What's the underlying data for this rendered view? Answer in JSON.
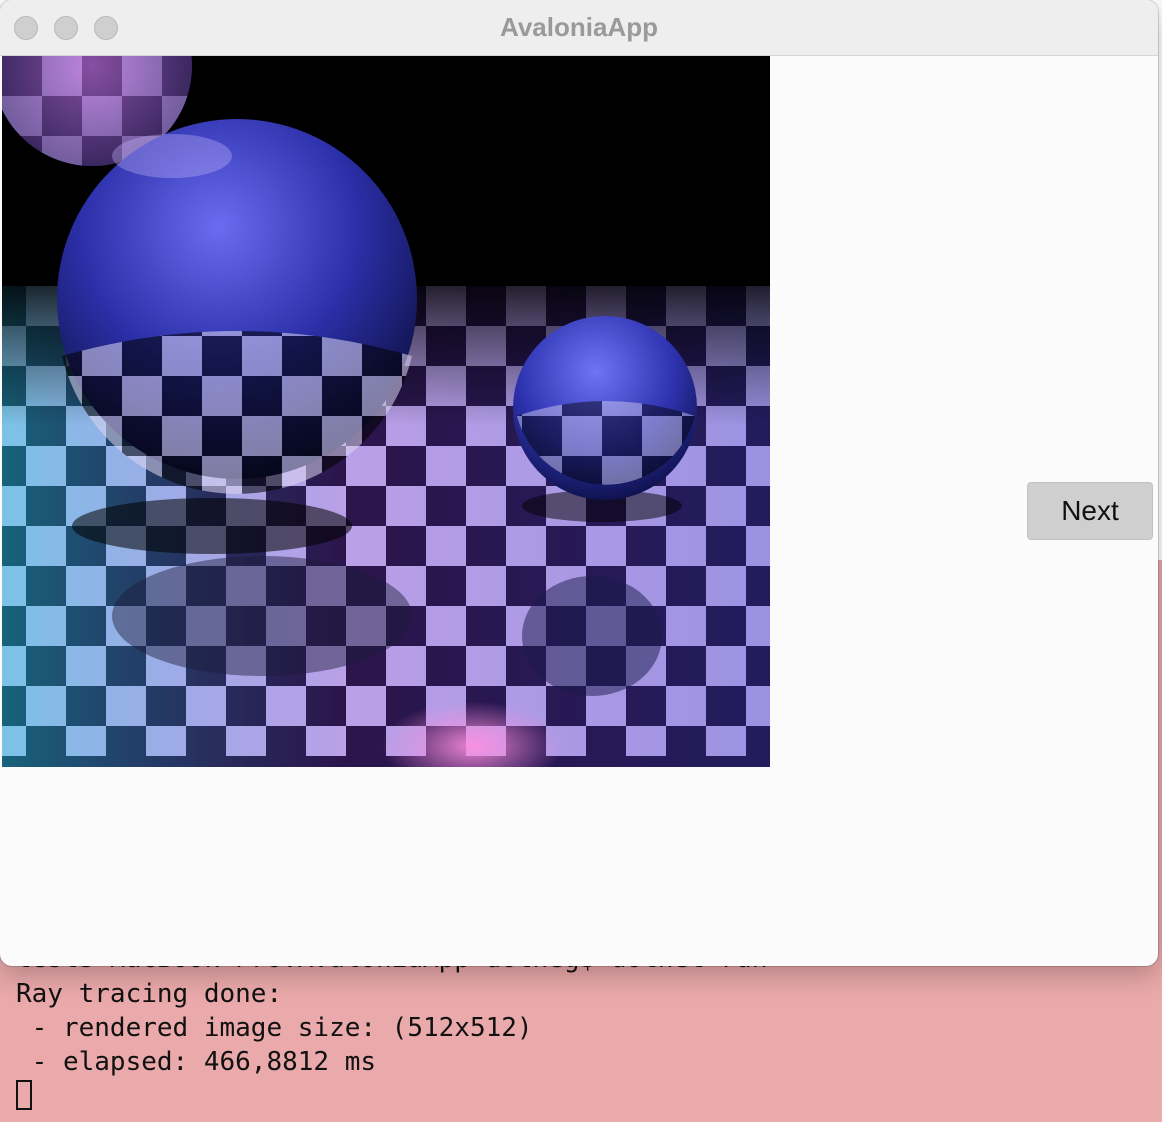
{
  "window": {
    "title": "AvaloniaApp",
    "controls": [
      "close",
      "minimize",
      "zoom"
    ]
  },
  "render": {
    "image_icon": "raytraced-scene-image"
  },
  "actions": {
    "next_label": "Next"
  },
  "terminal": {
    "partial_line": "tests MacBook Pro:AvaloniaApp dotneg$ dotnet run",
    "lines": [
      "Ray tracing done:",
      " - rendered image size: (512x512)",
      " - elapsed: 466,8812 ms"
    ]
  },
  "colors": {
    "terminal_bg": "#eaa9aa",
    "window_bg": "#fbfbfb",
    "button_bg": "#cfcfcf"
  }
}
